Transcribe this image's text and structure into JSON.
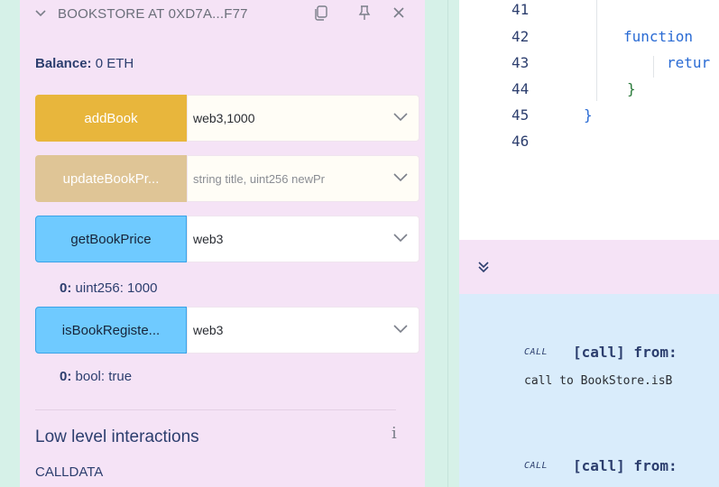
{
  "contract": {
    "title": "BOOKSTORE AT 0XD7A...F77",
    "balance_label": "Balance:",
    "balance_value": "0 ETH"
  },
  "functions": [
    {
      "label": "addBook",
      "value": "web3,1000"
    },
    {
      "label": "updateBookPr...",
      "placeholder": "string title, uint256 newPr"
    },
    {
      "label": "getBookPrice",
      "value": "web3"
    },
    {
      "label": "isBookRegiste...",
      "value": "web3"
    }
  ],
  "results": {
    "getBookPrice": {
      "key": "0:",
      "value": "uint256: 1000"
    },
    "isBookRegistered": {
      "key": "0:",
      "value": "bool: true"
    }
  },
  "low_level": {
    "title": "Low level interactions",
    "info": "i",
    "calldata_label": "CALLDATA"
  },
  "editor": {
    "lines": [
      {
        "n": "41",
        "code": ""
      },
      {
        "n": "42",
        "code": "function"
      },
      {
        "n": "43",
        "code": "retur"
      },
      {
        "n": "44",
        "code": "}"
      },
      {
        "n": "45",
        "code": "}"
      },
      {
        "n": "46",
        "code": ""
      }
    ]
  },
  "terminal": {
    "entries": [
      {
        "tag": "CALL",
        "title": "[call] from:",
        "detail": "call to BookStore.isB"
      },
      {
        "tag": "CALL",
        "title": "[call] from:"
      }
    ]
  },
  "colors": {
    "panel": "#f5e3f6",
    "orange_button": "#e8b63c",
    "tan_button": "#dfc596",
    "blue_button": "#6fcaff",
    "terminal": "#d9ecfb"
  }
}
